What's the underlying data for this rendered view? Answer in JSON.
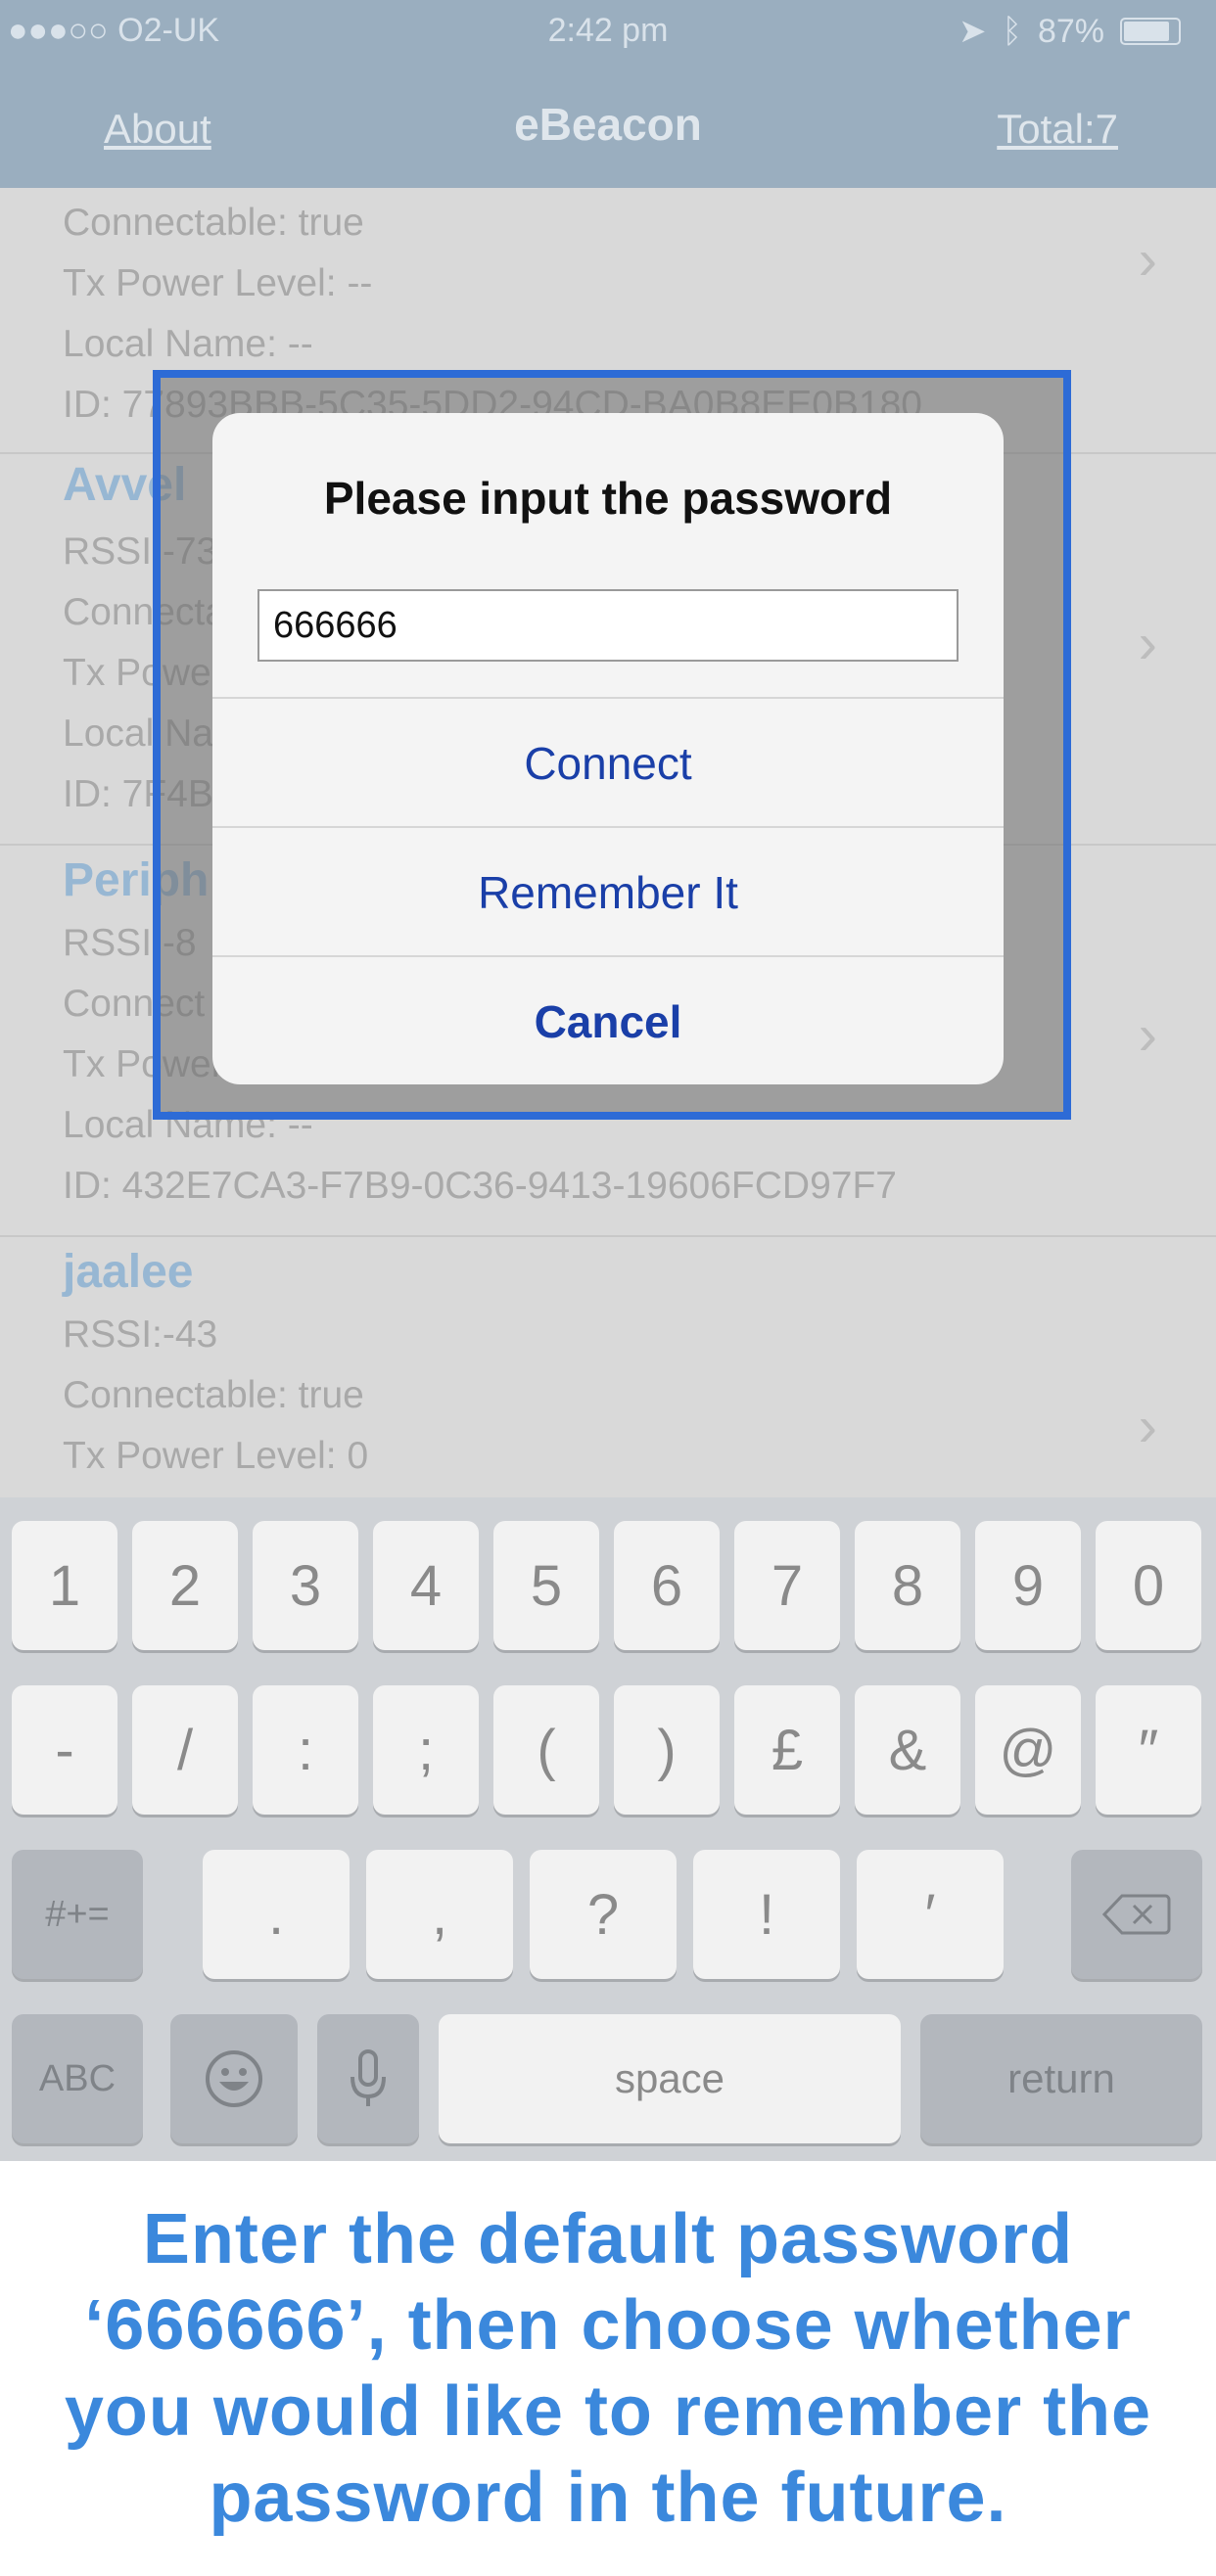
{
  "status_bar": {
    "carrier": "●●●○○ O2-UK",
    "time": "2:42 pm",
    "battery": "87%"
  },
  "nav": {
    "about": "About",
    "title": "eBeacon",
    "total": "Total:7"
  },
  "list": {
    "item0": {
      "connectable": "Connectable: true",
      "tx_power": "Tx Power Level:  --",
      "local_name": "Local Name:  --",
      "id": "ID: 77893BBB-5C35-5DD2-94CD-BA0B8EE0B180"
    },
    "item1": {
      "name": "Avvel",
      "rssi": "RSSI:-73",
      "connectable": "Connectable",
      "tx_power": "Tx Power",
      "local_name": "Local Na",
      "id": "ID: 7F4B"
    },
    "item2": {
      "name": "Periph",
      "rssi": "RSSI:-8",
      "connectable": "Connect",
      "tx_power": "Tx Power",
      "local_name": "Local Name:  --",
      "id": "ID: 432E7CA3-F7B9-0C36-9413-19606FCD97F7"
    },
    "item3": {
      "name": "jaalee",
      "rssi": "RSSI:-43",
      "connectable": "Connectable: true",
      "tx_power": "Tx Power Level:  0"
    }
  },
  "dialog": {
    "title": "Please input the password",
    "password_value": "666666",
    "connect": "Connect",
    "remember": "Remember It",
    "cancel": "Cancel"
  },
  "keyboard": {
    "row1": [
      "1",
      "2",
      "3",
      "4",
      "5",
      "6",
      "7",
      "8",
      "9",
      "0"
    ],
    "row2": [
      "-",
      "/",
      ":",
      ";",
      "(",
      ")",
      "£",
      "&",
      "@",
      "″"
    ],
    "row3": [
      ".",
      ",",
      "?",
      "!",
      "′"
    ],
    "symbols_toggle": "#+=",
    "abc": "ABC",
    "space": "space",
    "return": "return"
  },
  "caption": {
    "text": "Enter the default password ‘666666’, then choose whether you would like to remember the password in the future."
  },
  "colors": {
    "nav_bg": "#9aaebf",
    "dialog_button": "#1a3fa8",
    "focus_border": "#2d6bd6",
    "caption": "#3b88dc"
  }
}
